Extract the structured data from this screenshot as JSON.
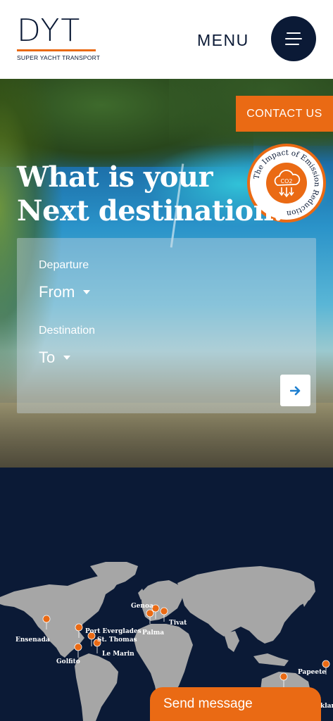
{
  "header": {
    "logo_letters": "DYT",
    "logo_tagline": "SUPER YACHT TRANSPORT",
    "menu_label": "MENU"
  },
  "hero": {
    "contact_label": "CONTACT US",
    "badge_text": "The Impact of Emission Reduction",
    "badge_co2": "CO2",
    "headline_line1": "What is your",
    "headline_line2": "Next destination."
  },
  "search_form": {
    "departure_label": "Departure",
    "departure_value": "From",
    "destination_label": "Destination",
    "destination_value": "To"
  },
  "map": {
    "locations": [
      "Ensenada",
      "Port Everglades",
      "St. Thomas",
      "Golfito",
      "Le Marin",
      "Genoa",
      "Palma",
      "Tivat",
      "Papeete",
      "klan"
    ]
  },
  "chat": {
    "send_message_label": "Send message"
  },
  "colors": {
    "accent": "#ea6a14",
    "navy": "#0b1a36",
    "land": "#a6a6a6"
  }
}
